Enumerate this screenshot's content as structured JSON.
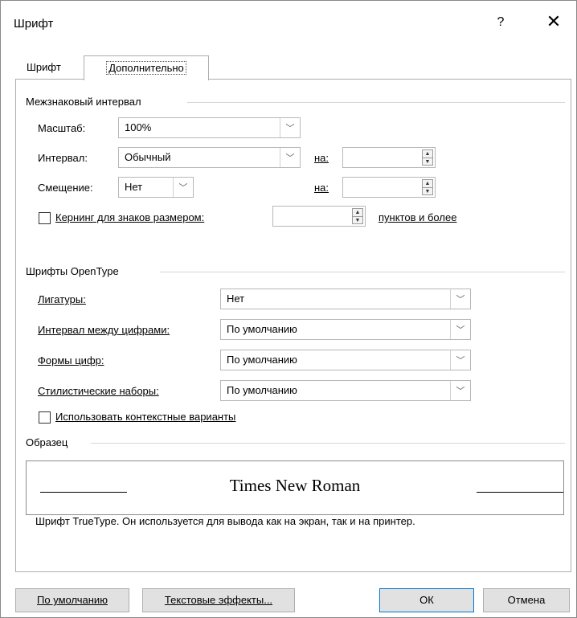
{
  "dialog": {
    "title": "Шрифт",
    "help_label": "?",
    "close_label": "✕"
  },
  "tabs": {
    "font": "Шрифт",
    "advanced": "Дополнительно"
  },
  "spacing": {
    "group_label": "Межзнаковый интервал",
    "scale_label": "Масштаб:",
    "scale_value": "100%",
    "interval_label": "Интервал:",
    "interval_value": "Обычный",
    "interval_by_label": "на:",
    "interval_by_value": "",
    "offset_label": "Смещение:",
    "offset_value": "Нет",
    "offset_by_label": "на:",
    "offset_by_value": "",
    "kerning_label": "Кернинг для знаков размером:",
    "kerning_checked": false,
    "kerning_value": "",
    "kerning_suffix": "пунктов и более"
  },
  "opentype": {
    "group_label": "Шрифты OpenType",
    "ligatures_label": "Лигатуры:",
    "ligatures_value": "Нет",
    "number_spacing_label": "Интервал между цифрами:",
    "number_spacing_value": "По умолчанию",
    "number_forms_label": "Формы цифр:",
    "number_forms_value": "По умолчанию",
    "stylistic_sets_label": "Стилистические наборы:",
    "stylistic_sets_value": "По умолчанию",
    "contextual_label": "Использовать контекстные варианты",
    "contextual_checked": false
  },
  "preview": {
    "group_label": "Образец",
    "sample_text": "Times New Roman",
    "description": "Шрифт TrueType. Он используется для вывода как на экран, так и на принтер."
  },
  "buttons": {
    "default": "По умолчанию",
    "text_effects": "Текстовые эффекты...",
    "ok": "ОК",
    "cancel": "Отмена"
  }
}
